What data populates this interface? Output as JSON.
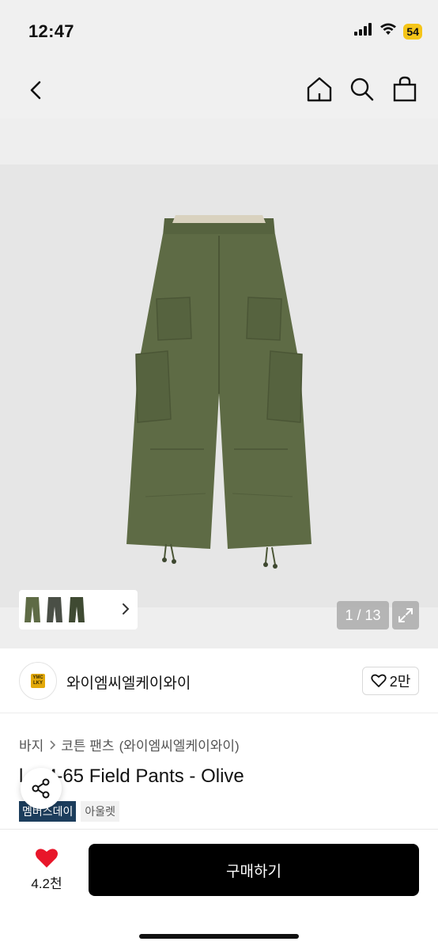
{
  "status_bar": {
    "time": "12:47",
    "battery": "54",
    "icons": [
      "signal-icon",
      "wifi-icon",
      "battery-icon"
    ]
  },
  "nav": {
    "back_icon": "chevron-left-icon",
    "actions": [
      "home-icon",
      "search-icon",
      "shopping-bag-icon"
    ]
  },
  "gallery": {
    "counter": "1 / 13",
    "expand_icon": "expand-icon",
    "thumb_chevron_icon": "chevron-right-icon"
  },
  "brand": {
    "name": "와이엠씨엘케이와이",
    "logo_text": "YMC LKY",
    "logo_color": "#e3a90a",
    "like_count": "2만"
  },
  "product": {
    "breadcrumb": {
      "category": "바지",
      "subcategory": "코튼 팬츠",
      "brand": "(와이엠씨엘케이와이)"
    },
    "title": "M-65 Field Pants - Olive",
    "title_prefix_fragment": "l",
    "tags": {
      "member_day": "멤버스데이",
      "outlet": "아울렛"
    }
  },
  "bottom_bar": {
    "favorite_count": "4.2천",
    "buy_label": "구매하기"
  },
  "colors": {
    "olive": "#5e6b45",
    "member_tag": "#1c3d5c",
    "heart": "#e8162a",
    "buy_button": "#000000"
  }
}
